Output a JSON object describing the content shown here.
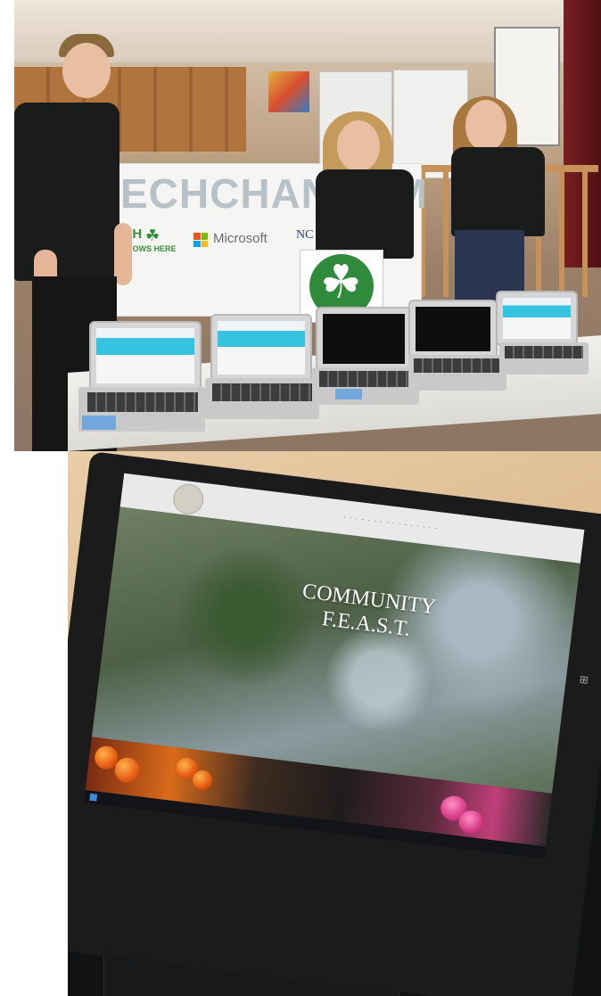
{
  "top_photo": {
    "banner_text": "ECHCHANGEM",
    "banner_4h_label": "4-H",
    "banner_4h_tagline": "GROWS HERE",
    "microsoft_label": "Microsoft",
    "nc_label": "NC"
  },
  "bottom_photo": {
    "website_title_line1": "COMMUNITY",
    "website_title_line2": "F.E.A.S.T."
  },
  "colors": {
    "microsoft_red": "#f25022",
    "microsoft_green": "#7fba00",
    "microsoft_blue": "#00a4ef",
    "microsoft_yellow": "#ffb900",
    "fourh_green": "#2f8a3b"
  }
}
